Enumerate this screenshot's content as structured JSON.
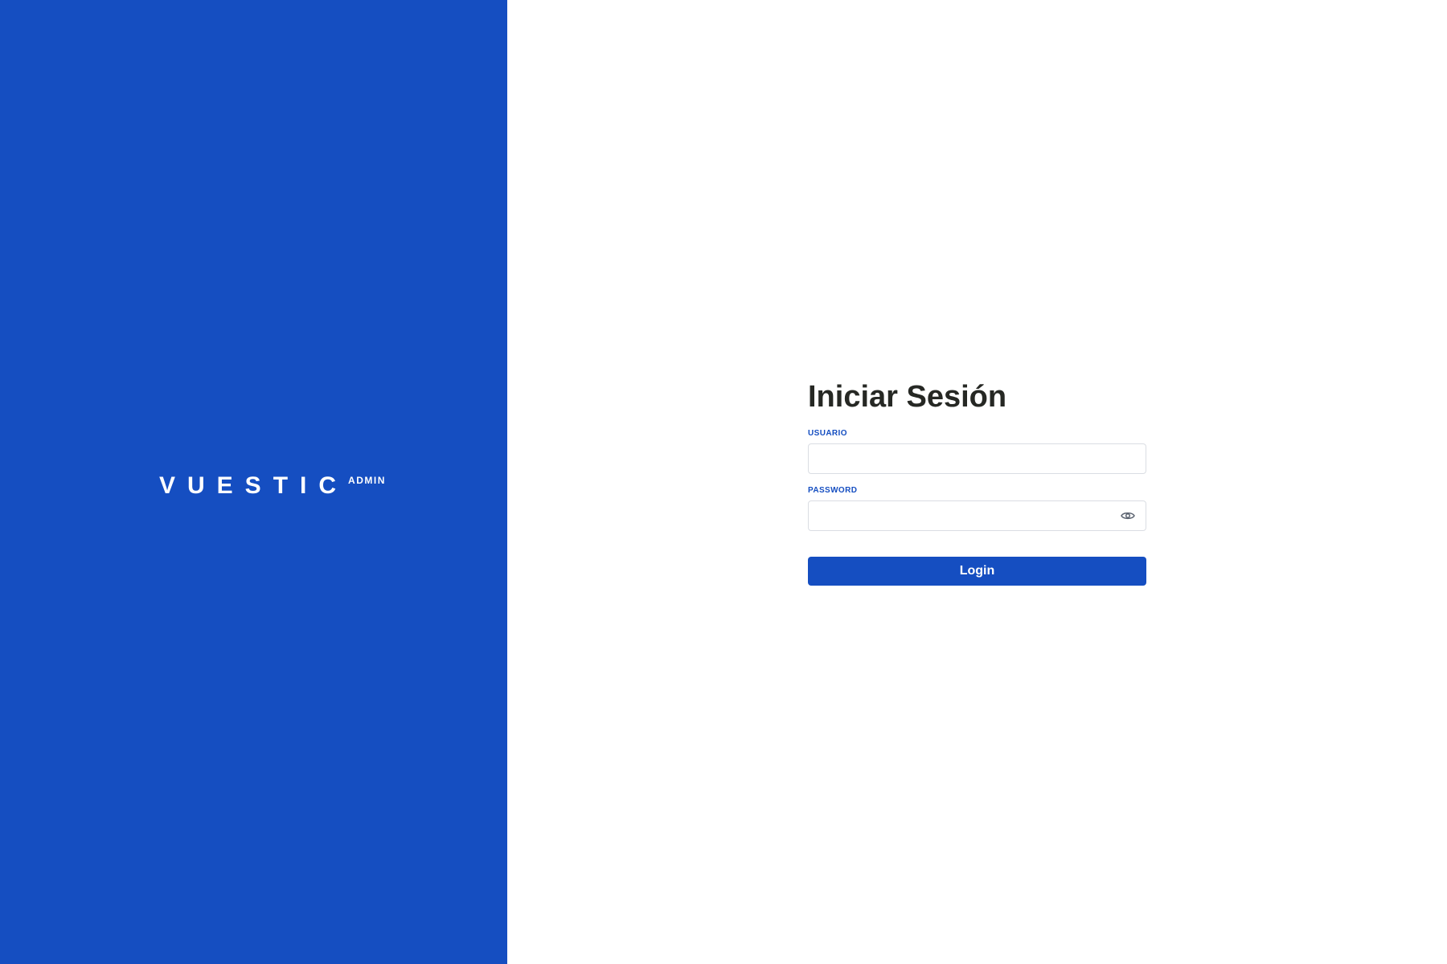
{
  "brand": {
    "name": "VUESTIC",
    "sub": "ADMIN",
    "background_color": "#154ec1"
  },
  "login_form": {
    "title": "Iniciar Sesión",
    "username": {
      "label": "USUARIO",
      "value": "",
      "placeholder": ""
    },
    "password": {
      "label": "PASSWORD",
      "value": "",
      "placeholder": "",
      "toggle_icon": "eye-icon"
    },
    "submit_label": "Login",
    "accent_color": "#154ec1"
  }
}
